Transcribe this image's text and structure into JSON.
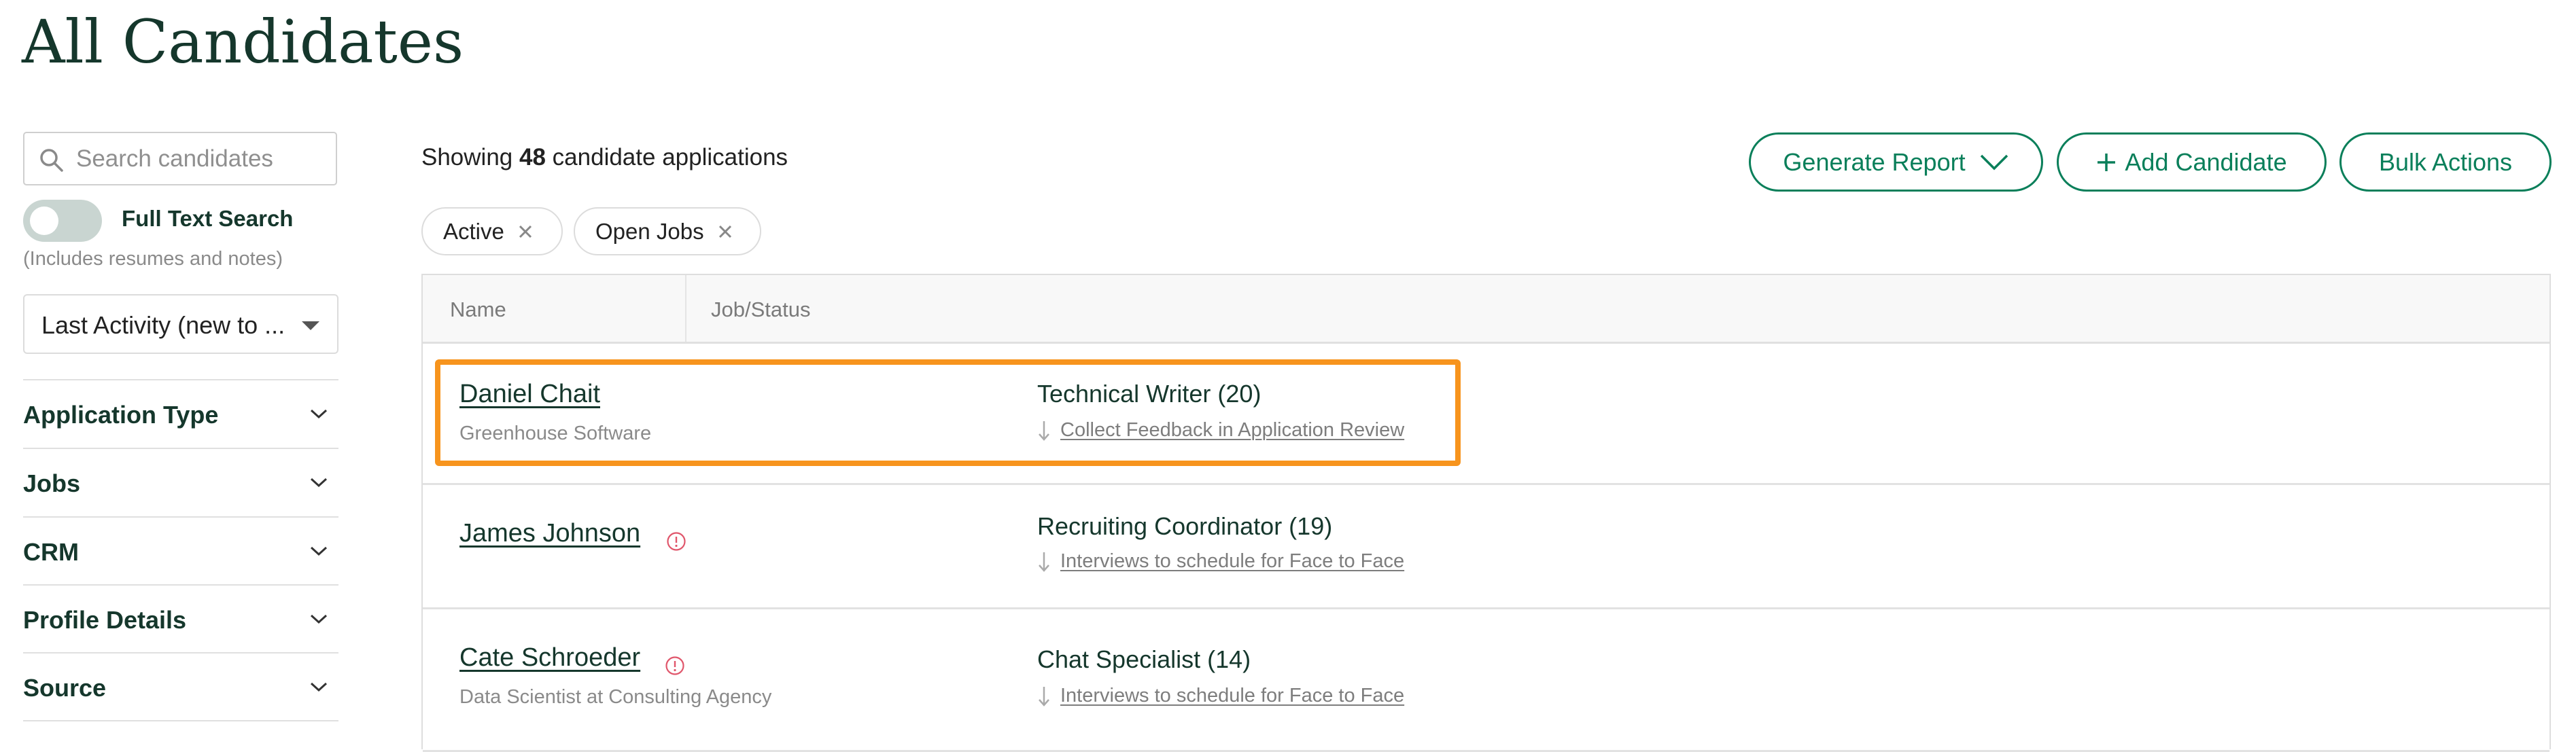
{
  "page": {
    "title": "All Candidates"
  },
  "sidebar": {
    "search_placeholder": "Search candidates",
    "full_text_search": {
      "label": "Full Text Search",
      "enabled": false,
      "hint": "(Includes resumes and notes)"
    },
    "sort": {
      "selected": "Last Activity (new to ..."
    },
    "facets": [
      {
        "label": "Application Type"
      },
      {
        "label": "Jobs"
      },
      {
        "label": "CRM"
      },
      {
        "label": "Profile Details"
      },
      {
        "label": "Source"
      }
    ]
  },
  "results": {
    "prefix": "Showing",
    "count": "48",
    "suffix": "candidate applications"
  },
  "filters": [
    {
      "label": "Active"
    },
    {
      "label": "Open Jobs"
    }
  ],
  "actions": {
    "generate_report": "Generate Report",
    "add_candidate": "Add Candidate",
    "bulk_actions": "Bulk Actions"
  },
  "table": {
    "columns": [
      "Name",
      "Job/Status"
    ],
    "rows": [
      {
        "name": "Daniel Chait",
        "subtitle": "Greenhouse Software",
        "warning": false,
        "job": "Technical Writer (20)",
        "status": "Collect Feedback in Application Review",
        "highlighted": true
      },
      {
        "name": "James Johnson",
        "subtitle": "",
        "warning": true,
        "job": "Recruiting Coordinator (19)",
        "status": "Interviews to schedule for Face to Face",
        "highlighted": false
      },
      {
        "name": "Cate Schroeder",
        "subtitle": "Data Scientist at Consulting Agency",
        "warning": true,
        "job": "Chat Specialist (14)",
        "status": "Interviews to schedule for Face to Face",
        "highlighted": false
      }
    ]
  },
  "colors": {
    "brand_green": "#0a7f5a",
    "text_dark_green": "#15372c",
    "highlight_orange": "#f7941d",
    "warning_red": "#e0566b",
    "muted_gray": "#8a8a8a"
  }
}
